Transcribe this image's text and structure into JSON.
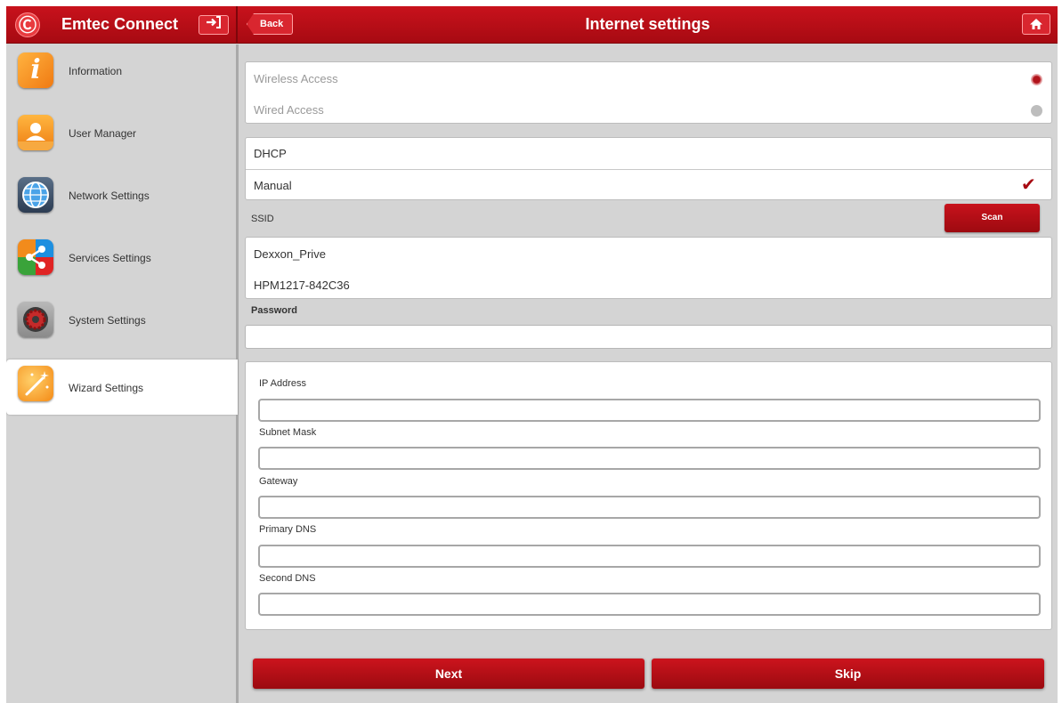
{
  "header": {
    "brand_logo": "Ⓒ",
    "brand_title": "Emtec Connect",
    "logout_icon": "logout-icon",
    "back_label": "Back",
    "page_title": "Internet settings",
    "home_icon": "home-icon"
  },
  "colors": {
    "accent_red": "#b1131a",
    "sidebar_bg": "#d4d4d4"
  },
  "sidebar": {
    "items": [
      {
        "label": "Information",
        "icon": "info-icon"
      },
      {
        "label": "User Manager",
        "icon": "user-icon"
      },
      {
        "label": "Network Settings",
        "icon": "globe-icon"
      },
      {
        "label": "Services Settings",
        "icon": "share-icon"
      },
      {
        "label": "System Settings",
        "icon": "gear-icon"
      },
      {
        "label": "Wizard Settings",
        "icon": "magic-wand-icon",
        "active": true
      }
    ]
  },
  "access": {
    "wireless_label": "Wireless Access",
    "wired_label": "Wired Access",
    "selected": "Wireless Access"
  },
  "ip_mode": {
    "dhcp_label": "DHCP",
    "manual_label": "Manual",
    "selected": "Manual",
    "check_glyph": "✔"
  },
  "wifi": {
    "ssid_label": "SSID",
    "scan_label": "Scan",
    "networks": [
      "Dexxon_Prive",
      "HPM1217-842C36"
    ],
    "password_label": "Password",
    "password_value": ""
  },
  "static_ip": {
    "ip_label": "IP Address",
    "subnet_label": "Subnet Mask",
    "gateway_label": "Gateway",
    "primary_dns_label": "Primary DNS",
    "second_dns_label": "Second DNS",
    "ip_value": "",
    "subnet_value": "",
    "gateway_value": "",
    "primary_dns_value": "",
    "second_dns_value": ""
  },
  "footer": {
    "next_label": "Next",
    "skip_label": "Skip"
  }
}
